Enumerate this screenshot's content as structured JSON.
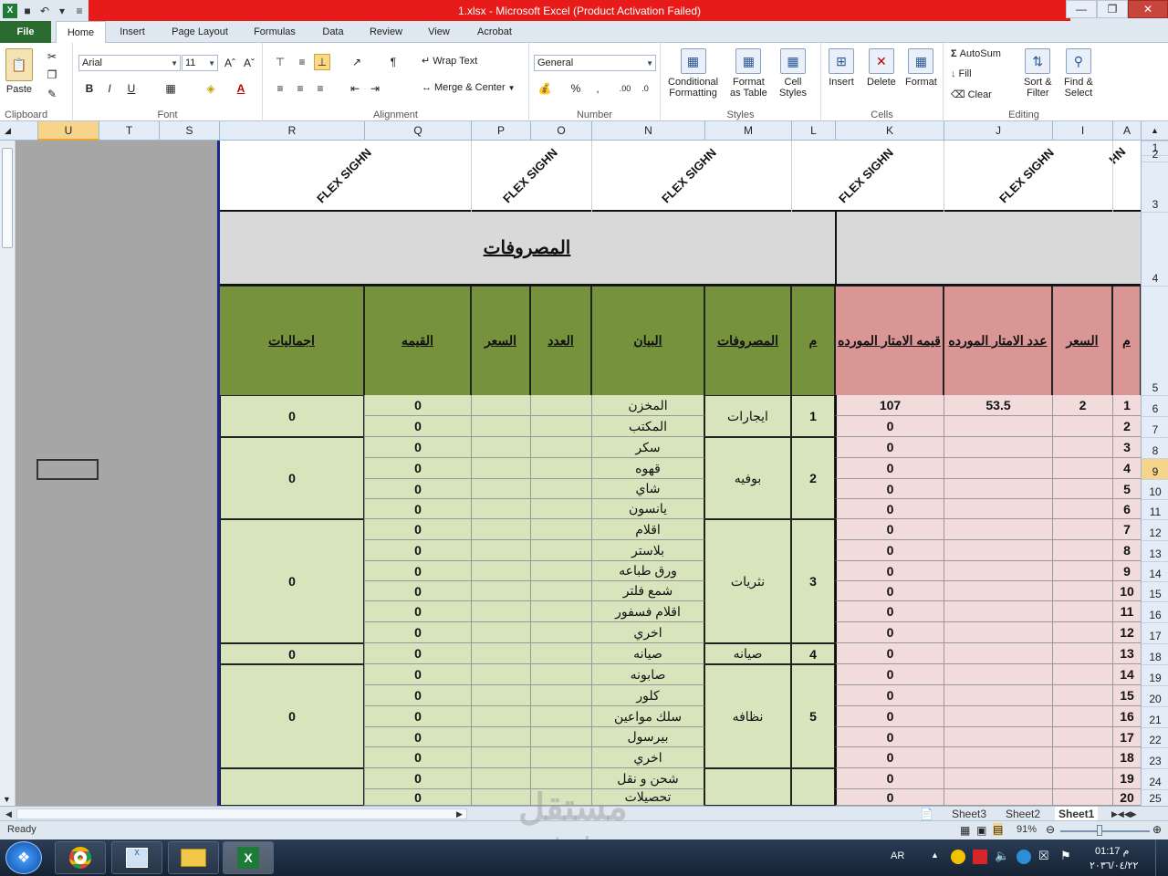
{
  "window": {
    "title": "1.xlsx - Microsoft Excel (Product Activation Failed)"
  },
  "tabs": [
    "File",
    "Home",
    "Insert",
    "Page Layout",
    "Formulas",
    "Data",
    "Review",
    "View",
    "Acrobat"
  ],
  "ribbon": {
    "clipboard": {
      "label": "Clipboard",
      "paste": "Paste"
    },
    "font": {
      "label": "Font",
      "name": "Arial",
      "size": "11"
    },
    "alignment": {
      "label": "Alignment",
      "wrap": "Wrap Text",
      "merge": "Merge & Center"
    },
    "number": {
      "label": "Number",
      "format": "General"
    },
    "styles": {
      "label": "Styles",
      "cond1": "Conditional",
      "cond2": "Formatting",
      "fmt1": "Format",
      "fmt2": "as Table",
      "cell1": "Cell",
      "cell2": "Styles"
    },
    "cells": {
      "label": "Cells",
      "insert": "Insert",
      "delete": "Delete",
      "format": "Format"
    },
    "editing": {
      "label": "Editing",
      "autosum": "AutoSum",
      "fill": "Fill",
      "clear": "Clear",
      "sort1": "Sort &",
      "sort2": "Filter",
      "find1": "Find &",
      "find2": "Select"
    }
  },
  "columns": [
    "U",
    "T",
    "S",
    "R",
    "Q",
    "P",
    "O",
    "N",
    "M",
    "L",
    "K",
    "J",
    "I",
    "A"
  ],
  "rows": [
    "1",
    "2",
    "3",
    "4",
    "5",
    "6",
    "7",
    "8",
    "9",
    "10",
    "11",
    "12",
    "13",
    "14",
    "15",
    "16",
    "17",
    "18",
    "19",
    "20",
    "21",
    "22",
    "23",
    "24",
    "25"
  ],
  "sheet": {
    "flex": "FLEX SIGHN",
    "flex_cut": "HN",
    "expenses_title": "المصروفات",
    "green_headers": {
      "r": "اجماليات",
      "q": "القيمه",
      "p": "السعر",
      "o": "العدد",
      "n": "البيان",
      "m": "المصروفات",
      "l": "م"
    },
    "pink_headers": {
      "k": "قيمه الامتار المورده",
      "j": "عدد الامتار المورده",
      "i": "السعر",
      "a": "م"
    },
    "groups": [
      {
        "num": "1",
        "name": "ايجارات",
        "total": "0"
      },
      {
        "num": "2",
        "name": "بوفيه",
        "total": "0"
      },
      {
        "num": "3",
        "name": "نثريات",
        "total": "0"
      },
      {
        "num": "4",
        "name": "صيانه",
        "total": "0"
      },
      {
        "num": "5",
        "name": "نظافه",
        "total": "0"
      }
    ],
    "items": [
      {
        "n": "المخزن",
        "q": "0",
        "k": "107",
        "j": "53.5",
        "i": "2",
        "a": "1"
      },
      {
        "n": "المكتب",
        "q": "0",
        "k": "0",
        "j": "",
        "i": "",
        "a": "2"
      },
      {
        "n": "سكر",
        "q": "0",
        "k": "0",
        "j": "",
        "i": "",
        "a": "3"
      },
      {
        "n": "قهوه",
        "q": "0",
        "k": "0",
        "j": "",
        "i": "",
        "a": "4"
      },
      {
        "n": "شاي",
        "q": "0",
        "k": "0",
        "j": "",
        "i": "",
        "a": "5"
      },
      {
        "n": "يانسون",
        "q": "0",
        "k": "0",
        "j": "",
        "i": "",
        "a": "6"
      },
      {
        "n": "اقلام",
        "q": "0",
        "k": "0",
        "j": "",
        "i": "",
        "a": "7"
      },
      {
        "n": "بلاستر",
        "q": "0",
        "k": "0",
        "j": "",
        "i": "",
        "a": "8"
      },
      {
        "n": "ورق طباعه",
        "q": "0",
        "k": "0",
        "j": "",
        "i": "",
        "a": "9"
      },
      {
        "n": "شمع فلتر",
        "q": "0",
        "k": "0",
        "j": "",
        "i": "",
        "a": "10"
      },
      {
        "n": "اقلام فسفور",
        "q": "0",
        "k": "0",
        "j": "",
        "i": "",
        "a": "11"
      },
      {
        "n": "اخري",
        "q": "0",
        "k": "0",
        "j": "",
        "i": "",
        "a": "12"
      },
      {
        "n": "صيانه",
        "q": "0",
        "k": "0",
        "j": "",
        "i": "",
        "a": "13"
      },
      {
        "n": "صابونه",
        "q": "0",
        "k": "0",
        "j": "",
        "i": "",
        "a": "14"
      },
      {
        "n": "كلور",
        "q": "0",
        "k": "0",
        "j": "",
        "i": "",
        "a": "15"
      },
      {
        "n": "سلك مواعين",
        "q": "0",
        "k": "0",
        "j": "",
        "i": "",
        "a": "16"
      },
      {
        "n": "بيرسول",
        "q": "0",
        "k": "0",
        "j": "",
        "i": "",
        "a": "17"
      },
      {
        "n": "اخري",
        "q": "0",
        "k": "0",
        "j": "",
        "i": "",
        "a": "18"
      },
      {
        "n": "شحن و نقل",
        "q": "0",
        "k": "0",
        "j": "",
        "i": "",
        "a": "19"
      },
      {
        "n": "تحصيلات",
        "q": "0",
        "k": "0",
        "j": "",
        "i": "",
        "a": "20"
      }
    ]
  },
  "sheet_tabs": [
    "Sheet3",
    "Sheet2",
    "Sheet1"
  ],
  "status": {
    "ready": "Ready",
    "zoom": "91%"
  },
  "taskbar": {
    "lang": "AR",
    "time": "01:17 م",
    "date": "٢٠٣٦/٠٤/٢٢"
  },
  "watermark": {
    "ar": "مستقل",
    "en": "mostaql.com"
  }
}
